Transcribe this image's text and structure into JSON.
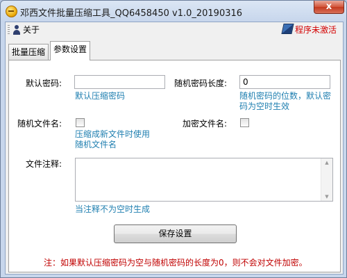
{
  "window": {
    "title": "邓西文件批量压缩工具_QQ6458450 v1.0_20190316",
    "close_glyph": "x"
  },
  "menu": {
    "about_label": "关于",
    "activate_label": "程序未激活"
  },
  "tabs": [
    {
      "label": "批量压缩",
      "active": false
    },
    {
      "label": "参数设置",
      "active": true
    }
  ],
  "settings": {
    "default_password_label": "默认密码:",
    "default_password_value": "",
    "default_password_hint": "默认压缩密码",
    "random_password_length_label": "随机密码长度:",
    "random_password_length_value": "0",
    "random_password_length_hint": [
      "随机密码的位数，默认密",
      "码为空时生效"
    ],
    "random_filename_label": "随机文件名:",
    "random_filename_checked": false,
    "random_filename_hint": [
      "压缩成新文件时使用",
      "随机文件名"
    ],
    "encrypt_filename_label": "加密文件名:",
    "encrypt_filename_checked": false,
    "file_comment_label": "文件注释:",
    "file_comment_value": "",
    "file_comment_hint": "当注释不为空时生成",
    "save_button_label": "保存设置",
    "note": "注：如果默认压缩密码为空与随机密码的长度为0，则不会对文件加密。"
  },
  "colors": {
    "hint": "#1f7fb0",
    "note": "#c00000",
    "activate": "#d40000"
  }
}
